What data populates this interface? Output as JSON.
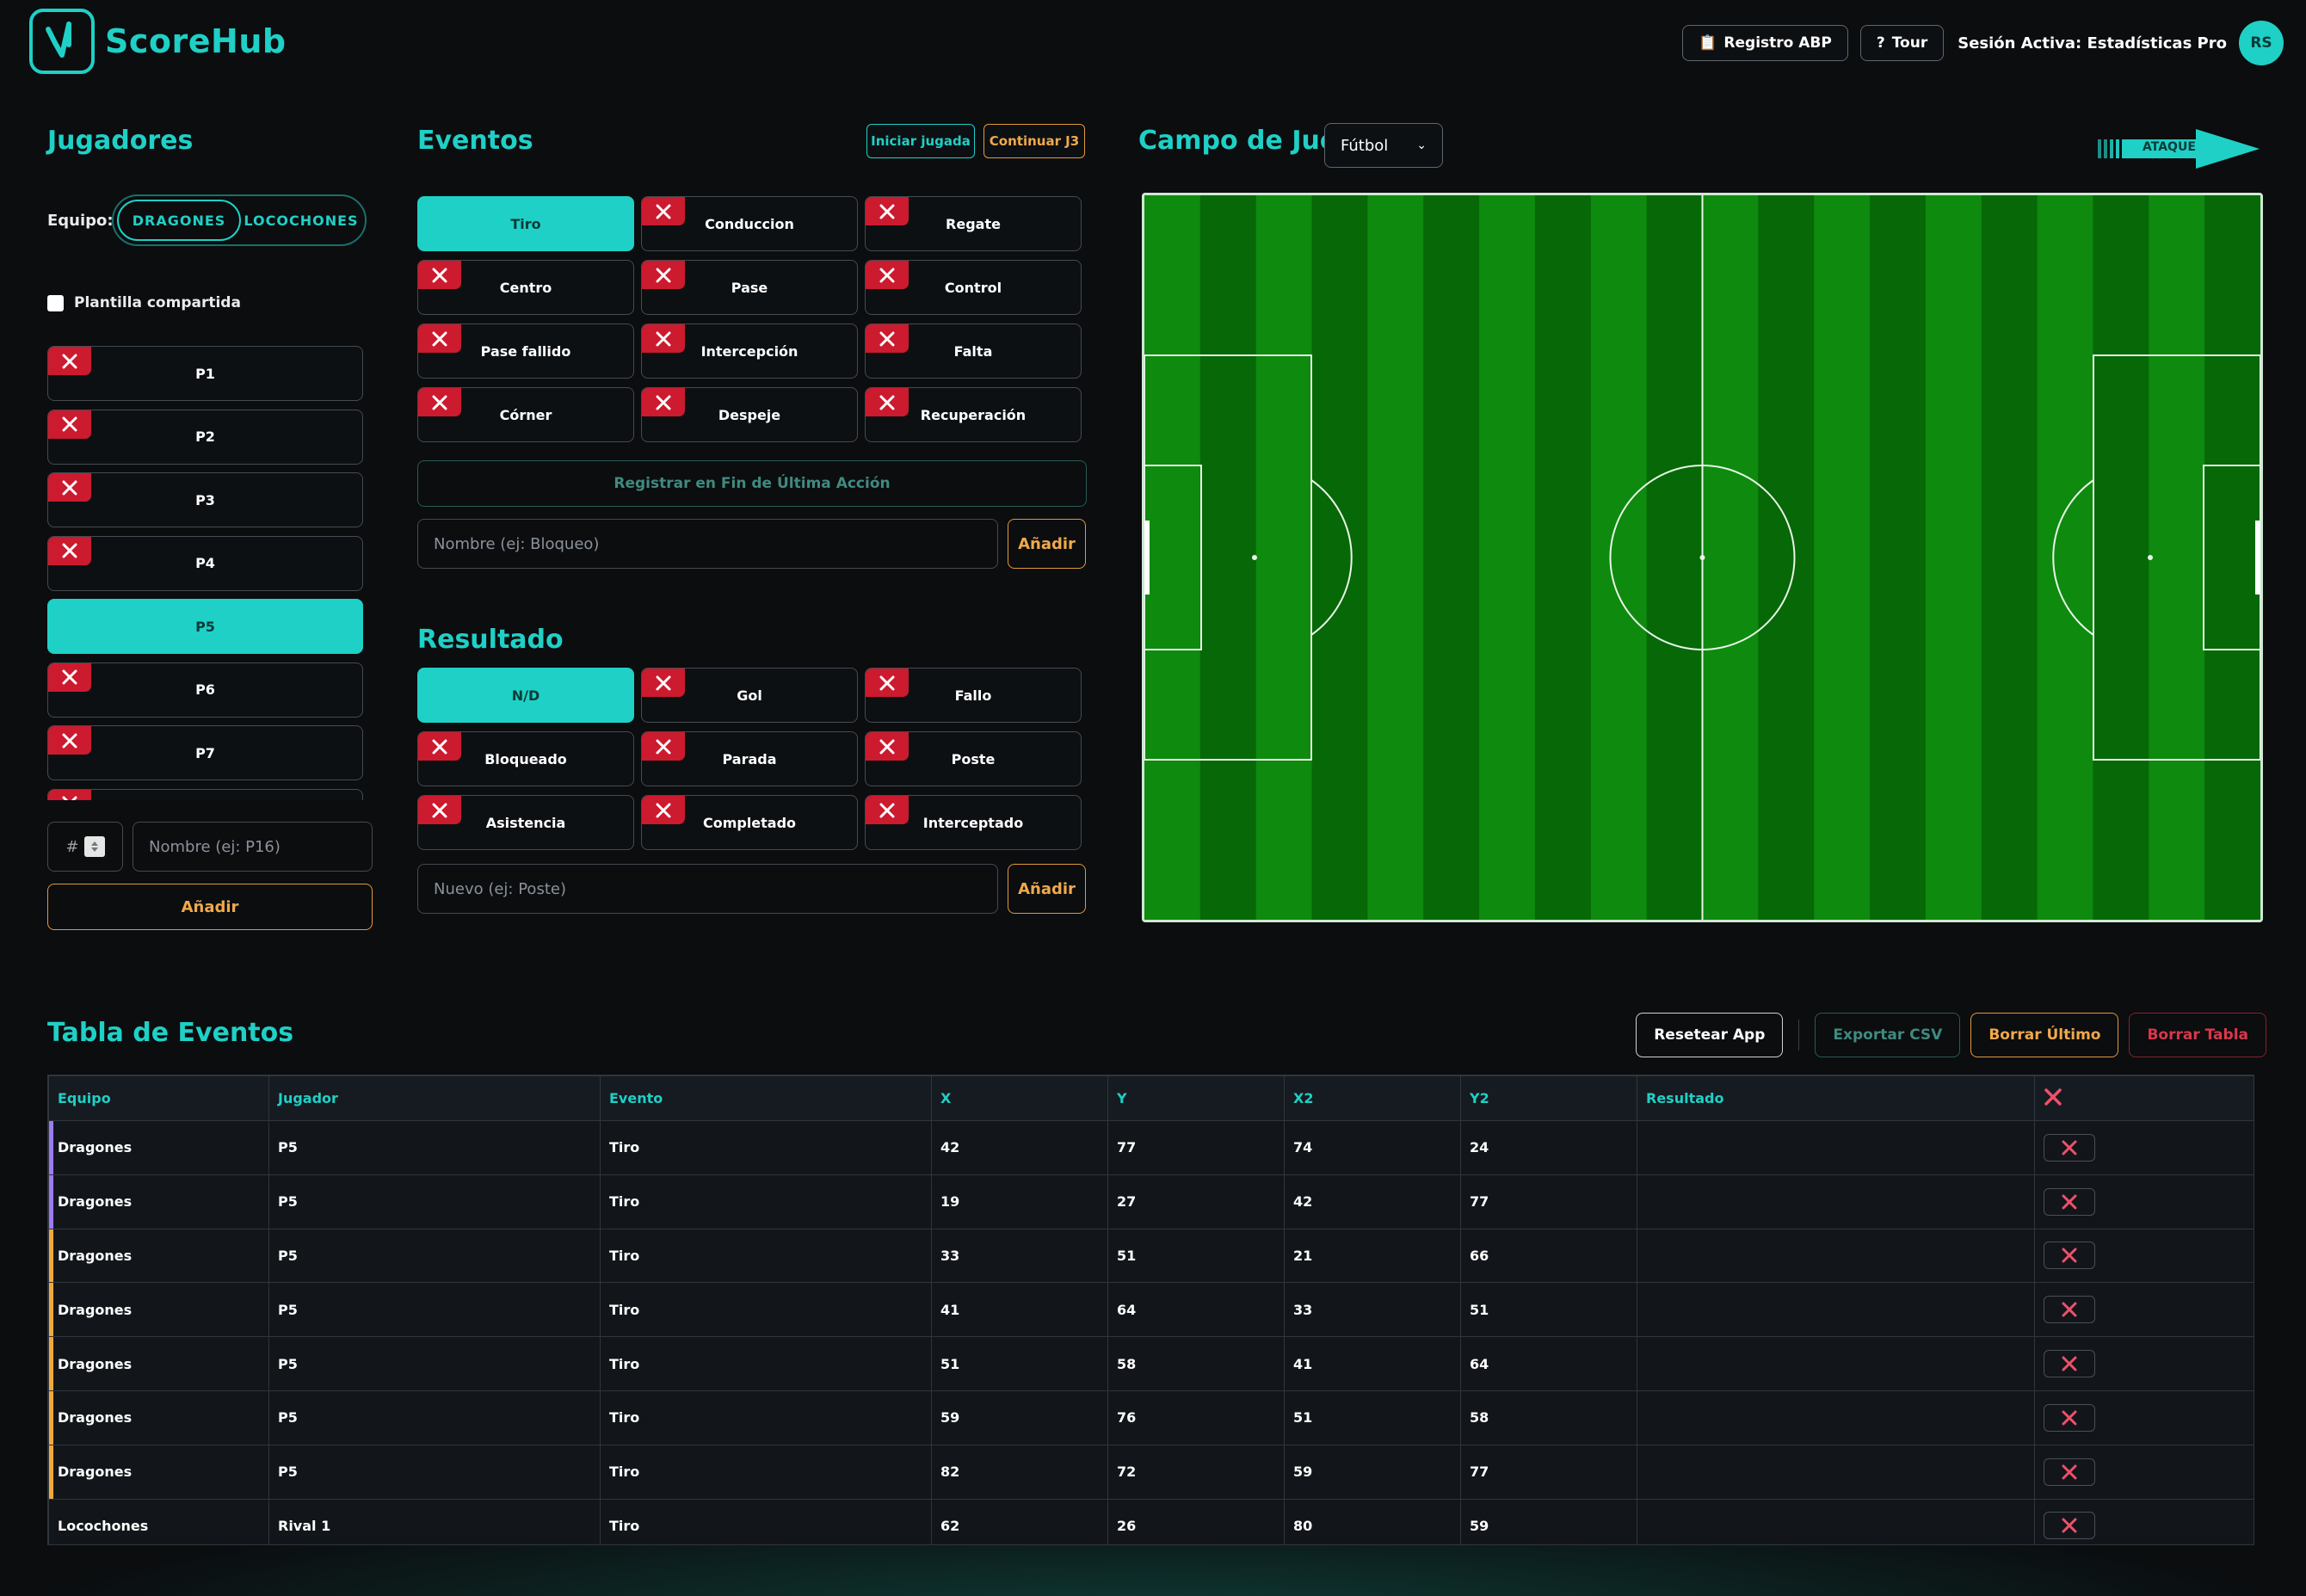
{
  "header": {
    "brand": "ScoreHub",
    "registro_label": "Registro ABP",
    "registro_icon": "clipboard-icon",
    "tour_label": "Tour",
    "tour_icon": "question-icon",
    "session_text": "Sesión Activa: Estadísticas Pro",
    "avatar_initials": "RS"
  },
  "players": {
    "title": "Jugadores",
    "team_label": "Equipo:",
    "teams": [
      "DRAGONES",
      "LOCOCHONES"
    ],
    "shared_label": "Plantilla compartida",
    "items": [
      {
        "label": "P1",
        "active": false
      },
      {
        "label": "P2",
        "active": false
      },
      {
        "label": "P3",
        "active": false
      },
      {
        "label": "P4",
        "active": false
      },
      {
        "label": "P5",
        "active": true
      },
      {
        "label": "P6",
        "active": false
      },
      {
        "label": "P7",
        "active": false
      },
      {
        "label": "",
        "active": false
      }
    ],
    "number_placeholder": "#",
    "name_placeholder": "Nombre (ej: P16)",
    "add_label": "Añadir"
  },
  "events": {
    "title": "Eventos",
    "start_play_label": "Iniciar jugada",
    "continue_label": "Continuar J3",
    "items": [
      {
        "label": "Tiro",
        "active": true
      },
      {
        "label": "Conduccion",
        "active": false
      },
      {
        "label": "Regate",
        "active": false
      },
      {
        "label": "Centro",
        "active": false
      },
      {
        "label": "Pase",
        "active": false
      },
      {
        "label": "Control",
        "active": false
      },
      {
        "label": "Pase fallido",
        "active": false
      },
      {
        "label": "Intercepción",
        "active": false
      },
      {
        "label": "Falta",
        "active": false
      },
      {
        "label": "Córner",
        "active": false
      },
      {
        "label": "Despeje",
        "active": false
      },
      {
        "label": "Recuperación",
        "active": false
      }
    ],
    "register_end_label": "Registrar en Fin de Última Acción",
    "name_placeholder": "Nombre (ej: Bloqueo)",
    "add_label": "Añadir"
  },
  "result": {
    "title": "Resultado",
    "items": [
      {
        "label": "N/D",
        "active": true
      },
      {
        "label": "Gol",
        "active": false
      },
      {
        "label": "Fallo",
        "active": false
      },
      {
        "label": "Bloqueado",
        "active": false
      },
      {
        "label": "Parada",
        "active": false
      },
      {
        "label": "Poste",
        "active": false
      },
      {
        "label": "Asistencia",
        "active": false
      },
      {
        "label": "Completado",
        "active": false
      },
      {
        "label": "Interceptado",
        "active": false
      }
    ],
    "new_placeholder": "Nuevo (ej: Poste)",
    "add_label": "Añadir"
  },
  "field": {
    "title": "Campo de Juego",
    "sport_selected": "Fútbol",
    "attack_label": "ATAQUE"
  },
  "table": {
    "title": "Tabla de Eventos",
    "reset_label": "Resetear App",
    "export_label": "Exportar CSV",
    "delete_last_label": "Borrar Último",
    "delete_table_label": "Borrar Tabla",
    "columns": [
      "Equipo",
      "Jugador",
      "Evento",
      "X",
      "Y",
      "X2",
      "Y2",
      "Resultado"
    ],
    "rows": [
      {
        "team": "Dragones",
        "player": "P5",
        "event": "Tiro",
        "x": "42",
        "y": "77",
        "x2": "74",
        "y2": "24",
        "result": "",
        "marker": "#9b7cf2"
      },
      {
        "team": "Dragones",
        "player": "P5",
        "event": "Tiro",
        "x": "19",
        "y": "27",
        "x2": "42",
        "y2": "77",
        "result": "",
        "marker": "#9b7cf2"
      },
      {
        "team": "Dragones",
        "player": "P5",
        "event": "Tiro",
        "x": "33",
        "y": "51",
        "x2": "21",
        "y2": "66",
        "result": "",
        "marker": "#f2a93b"
      },
      {
        "team": "Dragones",
        "player": "P5",
        "event": "Tiro",
        "x": "41",
        "y": "64",
        "x2": "33",
        "y2": "51",
        "result": "",
        "marker": "#f2a93b"
      },
      {
        "team": "Dragones",
        "player": "P5",
        "event": "Tiro",
        "x": "51",
        "y": "58",
        "x2": "41",
        "y2": "64",
        "result": "",
        "marker": "#f2a93b"
      },
      {
        "team": "Dragones",
        "player": "P5",
        "event": "Tiro",
        "x": "59",
        "y": "76",
        "x2": "51",
        "y2": "58",
        "result": "",
        "marker": "#f2a93b"
      },
      {
        "team": "Dragones",
        "player": "P5",
        "event": "Tiro",
        "x": "82",
        "y": "72",
        "x2": "59",
        "y2": "77",
        "result": "",
        "marker": "#f2a93b"
      },
      {
        "team": "Locochones",
        "player": "Rival 1",
        "event": "Tiro",
        "x": "62",
        "y": "26",
        "x2": "80",
        "y2": "59",
        "result": "",
        "marker": ""
      }
    ]
  },
  "colors": {
    "accent": "#1fd0c6",
    "danger": "#cc1a2f",
    "warning": "#f0a94a",
    "background": "#0b0d0f",
    "pitch_light": "#0e8a0e",
    "pitch_dark": "#066806"
  }
}
